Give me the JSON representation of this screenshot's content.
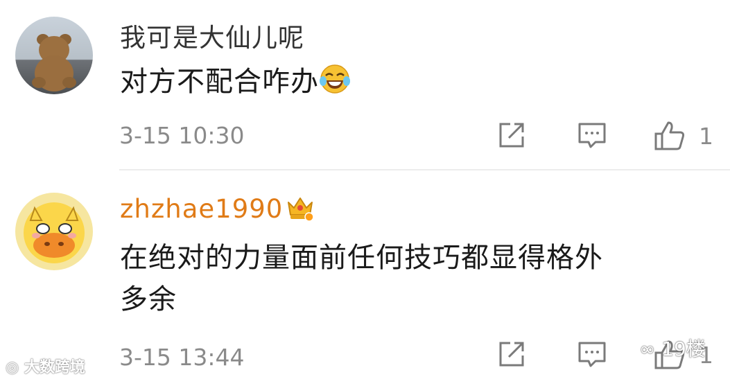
{
  "comments": [
    {
      "username": "我可是大仙儿呢",
      "text": "对方不配合咋办",
      "emoji": "laughing-tears-emoji",
      "time": "3-15 10:30",
      "likes": "1"
    },
    {
      "username": "zhzhae1990",
      "badge": "crown-badge",
      "text_line1": "在绝对的力量面前任何技巧都显得格外",
      "text_line2": "多余",
      "time": "3-15 13:44",
      "likes": "1"
    }
  ],
  "watermarks": {
    "left": "大数跨境",
    "right": "19楼"
  },
  "colors": {
    "username_vip": "#e07b17",
    "meta_gray": "#8a8a8a",
    "divider": "#ececec"
  }
}
